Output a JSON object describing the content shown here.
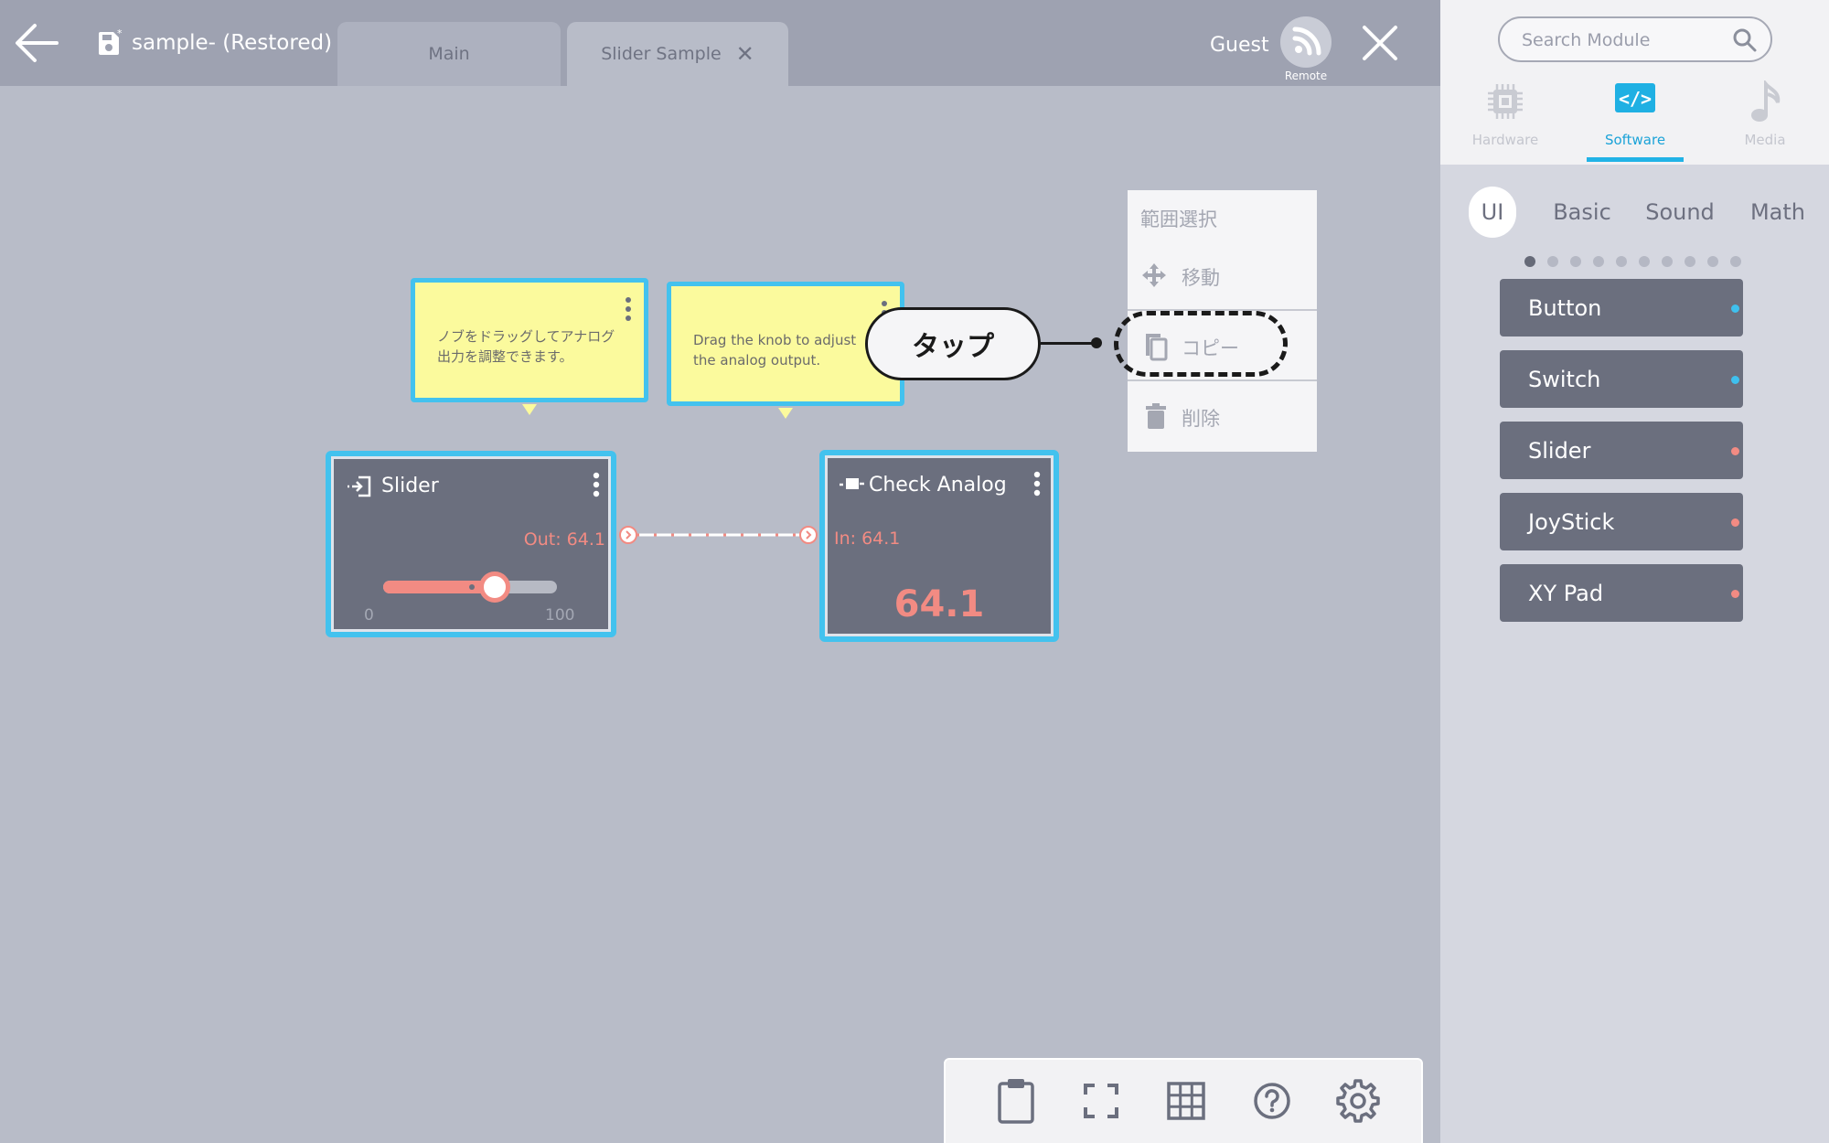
{
  "header": {
    "file_title": "sample- (Restored)",
    "tabs": [
      {
        "label": "Main"
      },
      {
        "label": "Slider Sample",
        "close": "✕"
      }
    ],
    "user": "Guest",
    "remote_label": "Remote"
  },
  "sidebar": {
    "search_placeholder": "Search Module",
    "categories": [
      {
        "label": "Hardware",
        "icon": "chip-icon"
      },
      {
        "label": "Software",
        "icon": "code-icon",
        "selected": true
      },
      {
        "label": "Media",
        "icon": "music-note-icon"
      }
    ],
    "subtabs": [
      "UI",
      "Basic",
      "Sound",
      "Math"
    ],
    "selected_subtab": "UI",
    "page_count": 10,
    "current_page": 1,
    "modules": [
      {
        "label": "Button",
        "dot_color": "#3fc0ee"
      },
      {
        "label": "Switch",
        "dot_color": "#3fc0ee"
      },
      {
        "label": "Slider",
        "dot_color": "#f28b83"
      },
      {
        "label": "JoyStick",
        "dot_color": "#f28b83"
      },
      {
        "label": "XY Pad",
        "dot_color": "#f28b83"
      }
    ]
  },
  "canvas": {
    "notes": [
      {
        "line1": "ノブをドラッグしてアナログ",
        "line2": "出力を調整できます。"
      },
      {
        "line1": "Drag the knob to adjust",
        "line2": "the analog output."
      }
    ],
    "slider_node": {
      "title": "Slider",
      "out_label": "Out: 64.1",
      "min": "0",
      "max": "100",
      "value": 64.1
    },
    "check_node": {
      "title": "Check Analog",
      "in_label": "In: 64.1",
      "display_value": "64.1"
    },
    "accent_color": "#f28b83",
    "selection_color": "#43c2ee"
  },
  "context_menu": {
    "items": [
      {
        "label": "範囲選択",
        "icon": ""
      },
      {
        "label": "移動",
        "icon": "move-icon"
      },
      {
        "label": "コピー",
        "icon": "copy-icon"
      },
      {
        "label": "削除",
        "icon": "trash-icon"
      }
    ]
  },
  "annotation": {
    "tap_label": "タップ"
  },
  "toolbar": {
    "tools": [
      "clipboard-icon",
      "fullscreen-icon",
      "grid-icon",
      "help-icon",
      "settings-icon"
    ]
  }
}
